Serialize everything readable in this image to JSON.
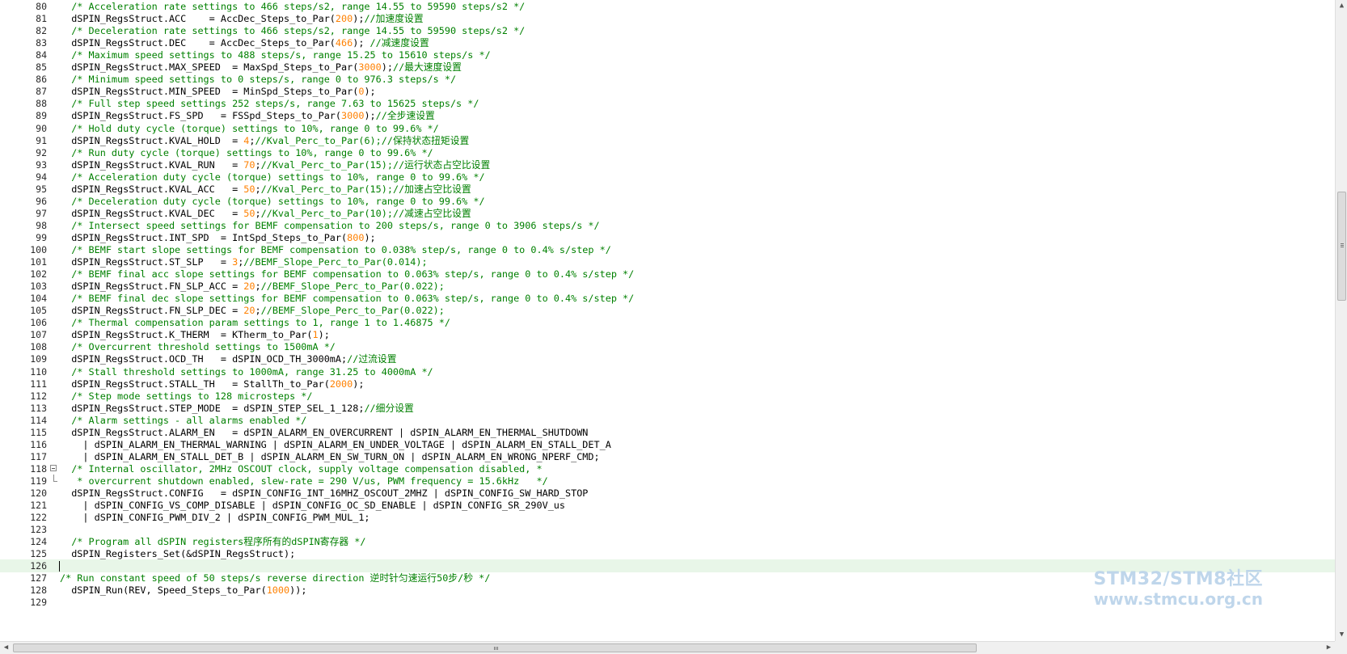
{
  "editor": {
    "lines": [
      {
        "n": "80",
        "segs": [
          [
            "c",
            "  /* Acceleration rate settings to 466 steps/s2, range 14.55 to 59590 steps/s2 */"
          ]
        ]
      },
      {
        "n": "81",
        "segs": [
          [
            "p",
            "  dSPIN_RegsStruct.ACC    = AccDec_Steps_to_Par("
          ],
          [
            "n",
            "200"
          ],
          [
            "p",
            ");"
          ],
          [
            "c",
            "//加速度设置"
          ]
        ]
      },
      {
        "n": "82",
        "segs": [
          [
            "c",
            "  /* Deceleration rate settings to 466 steps/s2, range 14.55 to 59590 steps/s2 */"
          ]
        ]
      },
      {
        "n": "83",
        "segs": [
          [
            "p",
            "  dSPIN_RegsStruct.DEC    = AccDec_Steps_to_Par("
          ],
          [
            "n",
            "466"
          ],
          [
            "p",
            "); "
          ],
          [
            "c",
            "//减速度设置"
          ]
        ]
      },
      {
        "n": "84",
        "segs": [
          [
            "c",
            "  /* Maximum speed settings to 488 steps/s, range 15.25 to 15610 steps/s */"
          ]
        ]
      },
      {
        "n": "85",
        "segs": [
          [
            "p",
            "  dSPIN_RegsStruct.MAX_SPEED  = MaxSpd_Steps_to_Par("
          ],
          [
            "n",
            "3000"
          ],
          [
            "p",
            ");"
          ],
          [
            "c",
            "//最大速度设置"
          ]
        ]
      },
      {
        "n": "86",
        "segs": [
          [
            "c",
            "  /* Minimum speed settings to 0 steps/s, range 0 to 976.3 steps/s */"
          ]
        ]
      },
      {
        "n": "87",
        "segs": [
          [
            "p",
            "  dSPIN_RegsStruct.MIN_SPEED  = MinSpd_Steps_to_Par("
          ],
          [
            "n",
            "0"
          ],
          [
            "p",
            ");"
          ]
        ]
      },
      {
        "n": "88",
        "segs": [
          [
            "c",
            "  /* Full step speed settings 252 steps/s, range 7.63 to 15625 steps/s */"
          ]
        ]
      },
      {
        "n": "89",
        "segs": [
          [
            "p",
            "  dSPIN_RegsStruct.FS_SPD   = FSSpd_Steps_to_Par("
          ],
          [
            "n",
            "3000"
          ],
          [
            "p",
            ");"
          ],
          [
            "c",
            "//全步速设置"
          ]
        ]
      },
      {
        "n": "90",
        "segs": [
          [
            "c",
            "  /* Hold duty cycle (torque) settings to 10%, range 0 to 99.6% */"
          ]
        ]
      },
      {
        "n": "91",
        "segs": [
          [
            "p",
            "  dSPIN_RegsStruct.KVAL_HOLD  = "
          ],
          [
            "n",
            "4"
          ],
          [
            "p",
            ";"
          ],
          [
            "c",
            "//Kval_Perc_to_Par(6);//保持状态扭矩设置"
          ]
        ]
      },
      {
        "n": "92",
        "segs": [
          [
            "c",
            "  /* Run duty cycle (torque) settings to 10%, range 0 to 99.6% */"
          ]
        ]
      },
      {
        "n": "93",
        "segs": [
          [
            "p",
            "  dSPIN_RegsStruct.KVAL_RUN   = "
          ],
          [
            "n",
            "70"
          ],
          [
            "p",
            ";"
          ],
          [
            "c",
            "//Kval_Perc_to_Par(15);//运行状态占空比设置"
          ]
        ]
      },
      {
        "n": "94",
        "segs": [
          [
            "c",
            "  /* Acceleration duty cycle (torque) settings to 10%, range 0 to 99.6% */"
          ]
        ]
      },
      {
        "n": "95",
        "segs": [
          [
            "p",
            "  dSPIN_RegsStruct.KVAL_ACC   = "
          ],
          [
            "n",
            "50"
          ],
          [
            "p",
            ";"
          ],
          [
            "c",
            "//Kval_Perc_to_Par(15);//加速占空比设置"
          ]
        ]
      },
      {
        "n": "96",
        "segs": [
          [
            "c",
            "  /* Deceleration duty cycle (torque) settings to 10%, range 0 to 99.6% */"
          ]
        ]
      },
      {
        "n": "97",
        "segs": [
          [
            "p",
            "  dSPIN_RegsStruct.KVAL_DEC   = "
          ],
          [
            "n",
            "50"
          ],
          [
            "p",
            ";"
          ],
          [
            "c",
            "//Kval_Perc_to_Par(10);//减速占空比设置"
          ]
        ]
      },
      {
        "n": "98",
        "segs": [
          [
            "c",
            "  /* Intersect speed settings for BEMF compensation to 200 steps/s, range 0 to 3906 steps/s */"
          ]
        ]
      },
      {
        "n": "99",
        "segs": [
          [
            "p",
            "  dSPIN_RegsStruct.INT_SPD  = IntSpd_Steps_to_Par("
          ],
          [
            "n",
            "800"
          ],
          [
            "p",
            ");"
          ]
        ]
      },
      {
        "n": "100",
        "segs": [
          [
            "c",
            "  /* BEMF start slope settings for BEMF compensation to 0.038% step/s, range 0 to 0.4% s/step */"
          ]
        ]
      },
      {
        "n": "101",
        "segs": [
          [
            "p",
            "  dSPIN_RegsStruct.ST_SLP   = "
          ],
          [
            "n",
            "3"
          ],
          [
            "p",
            ";"
          ],
          [
            "c",
            "//BEMF_Slope_Perc_to_Par(0.014);"
          ]
        ]
      },
      {
        "n": "102",
        "segs": [
          [
            "c",
            "  /* BEMF final acc slope settings for BEMF compensation to 0.063% step/s, range 0 to 0.4% s/step */"
          ]
        ]
      },
      {
        "n": "103",
        "segs": [
          [
            "p",
            "  dSPIN_RegsStruct.FN_SLP_ACC = "
          ],
          [
            "n",
            "20"
          ],
          [
            "p",
            ";"
          ],
          [
            "c",
            "//BEMF_Slope_Perc_to_Par(0.022);"
          ]
        ]
      },
      {
        "n": "104",
        "segs": [
          [
            "c",
            "  /* BEMF final dec slope settings for BEMF compensation to 0.063% step/s, range 0 to 0.4% s/step */"
          ]
        ]
      },
      {
        "n": "105",
        "segs": [
          [
            "p",
            "  dSPIN_RegsStruct.FN_SLP_DEC = "
          ],
          [
            "n",
            "20"
          ],
          [
            "p",
            ";"
          ],
          [
            "c",
            "//BEMF_Slope_Perc_to_Par(0.022);"
          ]
        ]
      },
      {
        "n": "106",
        "segs": [
          [
            "c",
            "  /* Thermal compensation param settings to 1, range 1 to 1.46875 */"
          ]
        ]
      },
      {
        "n": "107",
        "segs": [
          [
            "p",
            "  dSPIN_RegsStruct.K_THERM  = KTherm_to_Par("
          ],
          [
            "n",
            "1"
          ],
          [
            "p",
            ");"
          ]
        ]
      },
      {
        "n": "108",
        "segs": [
          [
            "c",
            "  /* Overcurrent threshold settings to 1500mA */"
          ]
        ]
      },
      {
        "n": "109",
        "segs": [
          [
            "p",
            "  dSPIN_RegsStruct.OCD_TH   = dSPIN_OCD_TH_3000mA;"
          ],
          [
            "c",
            "//过流设置"
          ]
        ]
      },
      {
        "n": "110",
        "segs": [
          [
            "c",
            "  /* Stall threshold settings to 1000mA, range 31.25 to 4000mA */"
          ]
        ]
      },
      {
        "n": "111",
        "segs": [
          [
            "p",
            "  dSPIN_RegsStruct.STALL_TH   = StallTh_to_Par("
          ],
          [
            "n",
            "2000"
          ],
          [
            "p",
            ");"
          ]
        ]
      },
      {
        "n": "112",
        "segs": [
          [
            "c",
            "  /* Step mode settings to 128 microsteps */"
          ]
        ]
      },
      {
        "n": "113",
        "segs": [
          [
            "p",
            "  dSPIN_RegsStruct.STEP_MODE  = dSPIN_STEP_SEL_1_128;"
          ],
          [
            "c",
            "//细分设置"
          ]
        ]
      },
      {
        "n": "114",
        "segs": [
          [
            "c",
            "  /* Alarm settings - all alarms enabled */"
          ]
        ]
      },
      {
        "n": "115",
        "segs": [
          [
            "p",
            "  dSPIN_RegsStruct.ALARM_EN   = dSPIN_ALARM_EN_OVERCURRENT | dSPIN_ALARM_EN_THERMAL_SHUTDOWN"
          ]
        ]
      },
      {
        "n": "116",
        "segs": [
          [
            "p",
            "    | dSPIN_ALARM_EN_THERMAL_WARNING | dSPIN_ALARM_EN_UNDER_VOLTAGE | dSPIN_ALARM_EN_STALL_DET_A"
          ]
        ]
      },
      {
        "n": "117",
        "segs": [
          [
            "p",
            "    | dSPIN_ALARM_EN_STALL_DET_B | dSPIN_ALARM_EN_SW_TURN_ON | dSPIN_ALARM_EN_WRONG_NPERF_CMD;"
          ]
        ]
      },
      {
        "n": "118",
        "fold": "box",
        "segs": [
          [
            "c",
            "  /* Internal oscillator, 2MHz OSCOUT clock, supply voltage compensation disabled, *"
          ]
        ]
      },
      {
        "n": "119",
        "fold": "end",
        "segs": [
          [
            "c",
            "   * overcurrent shutdown enabled, slew-rate = 290 V/us, PWM frequency = 15.6kHz   */"
          ]
        ]
      },
      {
        "n": "120",
        "segs": [
          [
            "p",
            "  dSPIN_RegsStruct.CONFIG   = dSPIN_CONFIG_INT_16MHZ_OSCOUT_2MHZ | dSPIN_CONFIG_SW_HARD_STOP"
          ]
        ]
      },
      {
        "n": "121",
        "segs": [
          [
            "p",
            "    | dSPIN_CONFIG_VS_COMP_DISABLE | dSPIN_CONFIG_OC_SD_ENABLE | dSPIN_CONFIG_SR_290V_us"
          ]
        ]
      },
      {
        "n": "122",
        "segs": [
          [
            "p",
            "    | dSPIN_CONFIG_PWM_DIV_2 | dSPIN_CONFIG_PWM_MUL_1;"
          ]
        ]
      },
      {
        "n": "123",
        "segs": [
          [
            "p",
            ""
          ]
        ]
      },
      {
        "n": "124",
        "segs": [
          [
            "c",
            "  /* Program all dSPIN registers程序所有的dSPIN寄存器 */"
          ]
        ]
      },
      {
        "n": "125",
        "segs": [
          [
            "p",
            "  dSPIN_Registers_Set(&dSPIN_RegsStruct);"
          ]
        ]
      },
      {
        "n": "126",
        "current": true,
        "segs": [
          [
            "p",
            ""
          ]
        ]
      },
      {
        "n": "127",
        "segs": [
          [
            "c",
            "/* Run constant speed of 50 steps/s reverse direction 逆时针匀速运行50步/秒 */"
          ]
        ]
      },
      {
        "n": "128",
        "segs": [
          [
            "p",
            "  dSPIN_Run(REV, Speed_Steps_to_Par("
          ],
          [
            "n",
            "1000"
          ],
          [
            "p",
            "));"
          ]
        ]
      },
      {
        "n": "129",
        "segs": [
          [
            "p",
            ""
          ]
        ]
      }
    ]
  },
  "watermark": {
    "line1": "STM32/STM8社区",
    "line2": "www.stmcu.org.cn"
  },
  "colors": {
    "comment": "#008000",
    "number": "#ff8000",
    "plain": "#000000",
    "current_line": "#e8f6e8",
    "watermark": "#bcd4ea"
  },
  "icons": {
    "scroll_up": "triangle-up-icon",
    "scroll_down": "triangle-down-icon",
    "scroll_left": "triangle-left-icon",
    "scroll_right": "triangle-right-icon",
    "fold": "fold-minus-icon"
  }
}
